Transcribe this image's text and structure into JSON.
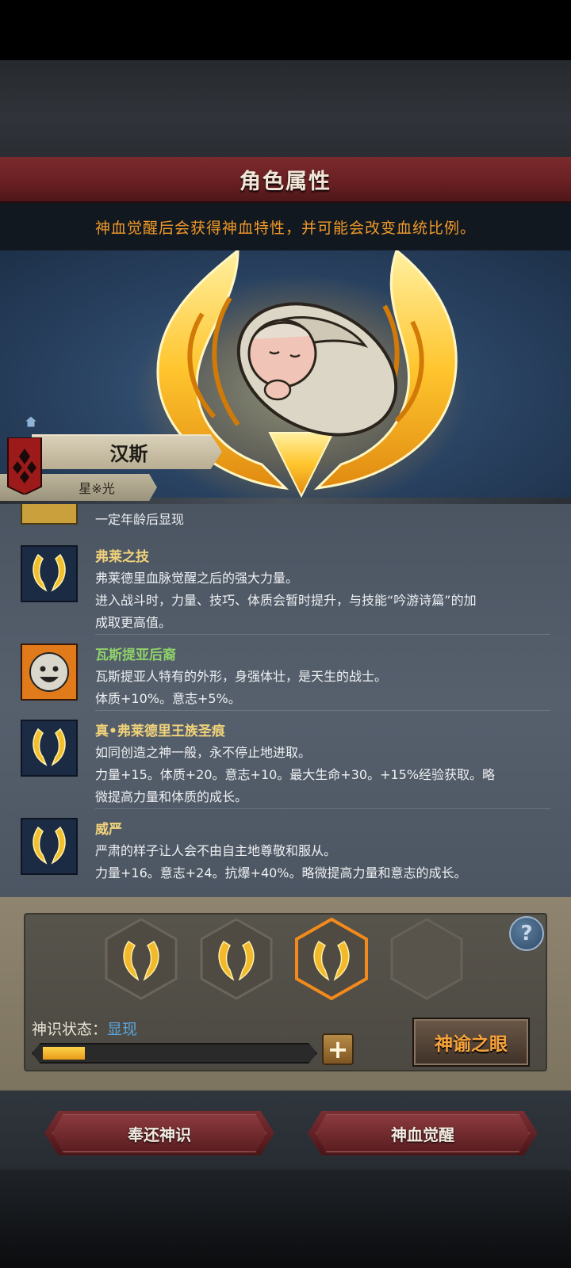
{
  "header": {
    "title": "角色属性"
  },
  "hint": "神血觉醒后会获得神血特性，并可能会改变血统比例。",
  "character": {
    "name": "汉斯",
    "title": "星※光"
  },
  "traits": [
    {
      "name": "",
      "lines": [
        "一定年龄后显现"
      ]
    },
    {
      "name": "弗莱之技",
      "lines": [
        "弗莱德里血脉觉醒之后的强大力量。",
        "进入战斗时，力量、技巧、体质会暂时提升，与技能“吟游诗篇”的加",
        "成取更高值。"
      ]
    },
    {
      "name": "瓦斯提亚后裔",
      "lines": [
        "瓦斯提亚人特有的外形，身强体壮，是天生的战士。",
        "体质+10%。意志+5%。"
      ]
    },
    {
      "name": "真•弗莱德里王族圣痕",
      "lines": [
        "如同创造之神一般，永不停止地进取。",
        "力量+15。体质+20。意志+10。最大生命+30。+15%经验获取。略",
        "微提高力量和体质的成长。"
      ]
    },
    {
      "name": "威严",
      "lines": [
        "严肃的样子让人会不由自主地尊敬和服从。",
        "力量+16。意志+24。抗爆+40%。略微提高力量和意志的成长。"
      ]
    }
  ],
  "panel": {
    "help_label": "?",
    "status_label": "神识状态：",
    "status_value": "显现",
    "progress": 0.16,
    "plus_label": "+",
    "oracle_button": "神谕之眼"
  },
  "buttons": {
    "return": "奉还神识",
    "awaken": "神血觉醒"
  },
  "colors": {
    "accent": "#f09a2a",
    "title_red": "#6a2023",
    "gold": "#f0d27a",
    "status_blue": "#5aa6e0"
  }
}
